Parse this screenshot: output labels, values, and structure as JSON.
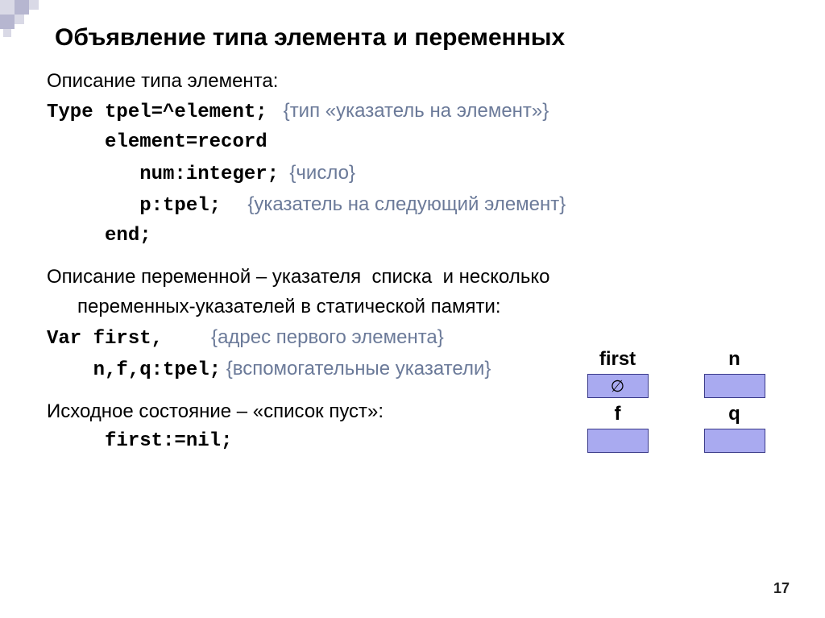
{
  "title": "Объявление типа элемента и переменных",
  "desc_type_label": "Описание типа элемента:",
  "code": {
    "line1_code": "Type tpel=^element;",
    "line1_comment": "{тип «указатель на элемент»}",
    "line2_code": "     element=record",
    "line3_code": "        num:integer;",
    "line3_comment": "{число}",
    "line4_code": "        p:tpel;",
    "line4_comment": "{указатель на следующий элемент}",
    "line5_code": "     end;"
  },
  "desc_var_l1": "Описание переменной – указателя  списка  и несколько",
  "desc_var_l2": "переменных-указателей в статической памяти:",
  "var_code": {
    "l1_code": "Var first,",
    "l1_comment": "{адрес первого элемента}",
    "l2_code": "    n,f,q:tpel;",
    "l2_comment": "{вспомогательные указатели}"
  },
  "initial_state": "Исходное состояние – «список пуст»:",
  "initial_code": "     first:=nil;",
  "boxes": {
    "first": "first",
    "n": "n",
    "f": "f",
    "q": "q",
    "empty_symbol": "∅"
  },
  "page_number": "17"
}
